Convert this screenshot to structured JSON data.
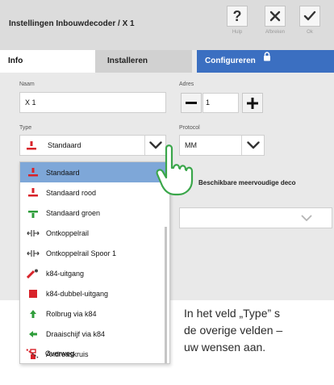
{
  "dialog": {
    "title": "Instellingen Inbouwdecoder / X 1",
    "toolbar": {
      "help_label": "Hulp",
      "cancel_label": "Afbreken",
      "ok_label": "Ok"
    }
  },
  "tabs": [
    {
      "label": "Info"
    },
    {
      "label": "Installeren"
    },
    {
      "label": "Configureren"
    }
  ],
  "form": {
    "name_label": "Naam",
    "name_value": "X 1",
    "address_label": "Adres",
    "address_value": "1",
    "type_label": "Type",
    "type_value": "Standaard",
    "protocol_label": "Protocol",
    "protocol_value": "MM",
    "multi_label": "Beschikbare meervoudige deco",
    "multi_value": ""
  },
  "type_options": [
    {
      "label": "Standaard",
      "icon": "red-signal-icon",
      "selected": true
    },
    {
      "label": "Standaard rood",
      "icon": "red-signal-icon"
    },
    {
      "label": "Standaard groen",
      "icon": "green-signal-icon"
    },
    {
      "label": "Ontkoppelrail",
      "icon": "uncoupler-icon"
    },
    {
      "label": "Ontkoppelrail Spoor 1",
      "icon": "uncoupler-icon"
    },
    {
      "label": "k84-uitgang",
      "icon": "k84-output-icon"
    },
    {
      "label": "k84-dubbel-uitgang",
      "icon": "k84-double-output-icon"
    },
    {
      "label": "Rolbrug via k84",
      "icon": "transfer-table-icon"
    },
    {
      "label": "Draaischijf via k84",
      "icon": "turntable-icon"
    },
    {
      "label": "Andreaskruis",
      "icon": "andreas-cross-icon"
    },
    {
      "label": "Overweg",
      "icon": "level-crossing-icon"
    }
  ],
  "caption": {
    "line1": "In het veld „Type” s",
    "line2": "de overige velden –",
    "line3": "uw wensen aan."
  },
  "colors": {
    "accent_tab": "#3b6fc1",
    "selected_row": "#7ea7d8",
    "signal_red": "#d8232a",
    "signal_green": "#2e9d3a"
  }
}
